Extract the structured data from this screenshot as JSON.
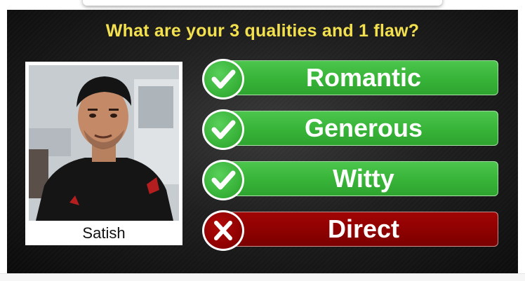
{
  "question": "What are your 3 qualities and 1 flaw?",
  "person": {
    "name": "Satish"
  },
  "answers": [
    {
      "label": "Romantic",
      "kind": "quality",
      "icon": "check-icon"
    },
    {
      "label": "Generous",
      "kind": "quality",
      "icon": "check-icon"
    },
    {
      "label": "Witty",
      "kind": "quality",
      "icon": "check-icon"
    },
    {
      "label": "Direct",
      "kind": "flaw",
      "icon": "cross-icon"
    }
  ],
  "colors": {
    "question_text": "#f3e04f",
    "quality_green": "#37b338",
    "flaw_red": "#8c0101",
    "background": "#1f1f1f"
  }
}
